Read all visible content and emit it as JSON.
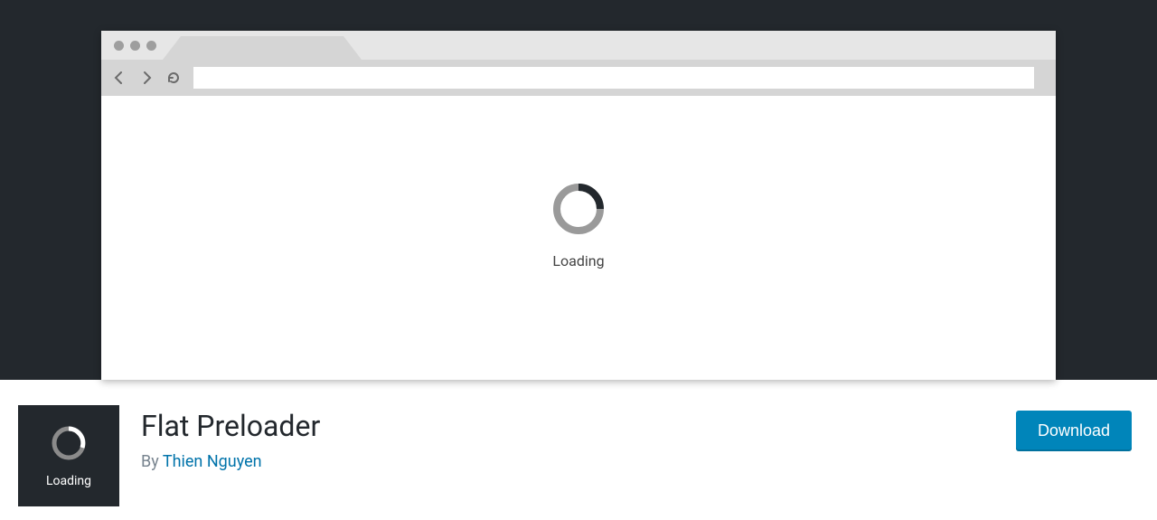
{
  "banner": {
    "loading_text": "Loading"
  },
  "plugin": {
    "title": "Flat Preloader",
    "by": "By ",
    "author": "Thien Nguyen",
    "icon_text": "Loading",
    "download_label": "Download"
  }
}
